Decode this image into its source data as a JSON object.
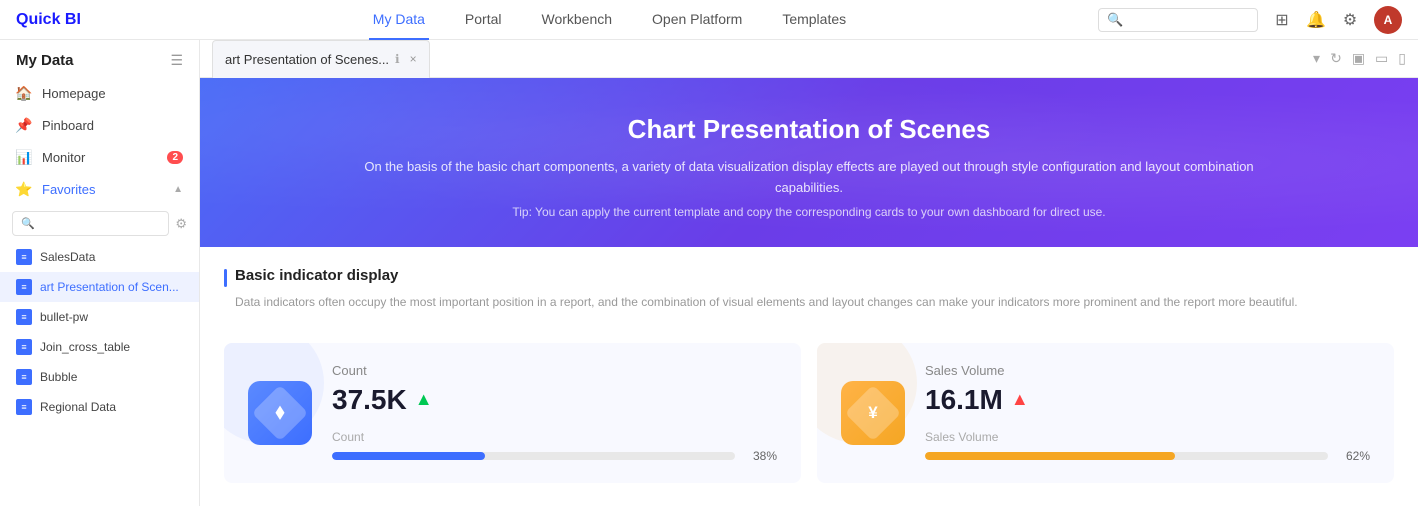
{
  "app": {
    "logo": "Quick BI"
  },
  "topnav": {
    "links": [
      {
        "id": "my-data",
        "label": "My Data",
        "active": true
      },
      {
        "id": "portal",
        "label": "Portal",
        "active": false
      },
      {
        "id": "workbench",
        "label": "Workbench",
        "active": false
      },
      {
        "id": "open-platform",
        "label": "Open Platform",
        "active": false
      },
      {
        "id": "templates",
        "label": "Templates",
        "active": false
      }
    ],
    "search_placeholder": "Search"
  },
  "sidebar": {
    "title": "My Data",
    "items": [
      {
        "id": "homepage",
        "label": "Homepage",
        "icon": "🏠",
        "badge": null
      },
      {
        "id": "pinboard",
        "label": "Pinboard",
        "icon": "📌",
        "badge": null
      },
      {
        "id": "monitor",
        "label": "Monitor",
        "icon": "📊",
        "badge": "2"
      }
    ],
    "favorites": {
      "label": "Favorites",
      "active": true,
      "search_placeholder": "Search"
    },
    "list_items": [
      {
        "id": "salesdata",
        "label": "SalesData"
      },
      {
        "id": "art-presentation",
        "label": "art Presentation of Scen...",
        "selected": true
      },
      {
        "id": "bullet-pw",
        "label": "bullet-pw"
      },
      {
        "id": "join-cross-table",
        "label": "Join_cross_table"
      },
      {
        "id": "bubble",
        "label": "Bubble"
      },
      {
        "id": "regional-data",
        "label": "Regional Data"
      }
    ]
  },
  "tab": {
    "label": "art Presentation of Scenes...",
    "close_label": "×"
  },
  "hero": {
    "title": "Chart Presentation of Scenes",
    "subtitle": "On the basis of the basic chart components, a variety of data visualization display effects are played out through style configuration and layout combination capabilities.",
    "tip": "Tip: You can apply the current template and copy the corresponding cards to your own dashboard for direct use."
  },
  "section": {
    "title": "Basic indicator display",
    "desc": "Data indicators often occupy the most important position in a report, and the combination of visual elements and layout changes can make your indicators more prominent and the report more beautiful."
  },
  "cards": [
    {
      "id": "count-card",
      "icon_symbol": "◇",
      "icon_color": "blue",
      "label": "Count",
      "value": "37.5K",
      "trend": "up",
      "progress_label": "Count",
      "progress_pct": "38%",
      "progress_value": 38,
      "progress_color": "blue"
    },
    {
      "id": "sales-volume-card",
      "icon_symbol": "¥",
      "icon_color": "orange",
      "label": "Sales Volume",
      "value": "16.1M",
      "trend": "up",
      "progress_label": "Sales Volume",
      "progress_pct": "62%",
      "progress_value": 62,
      "progress_color": "orange"
    }
  ],
  "tab_bar_icons": {
    "dropdown": "▾",
    "refresh": "↻",
    "desktop": "▣",
    "tablet": "▭",
    "mobile": "▯"
  }
}
